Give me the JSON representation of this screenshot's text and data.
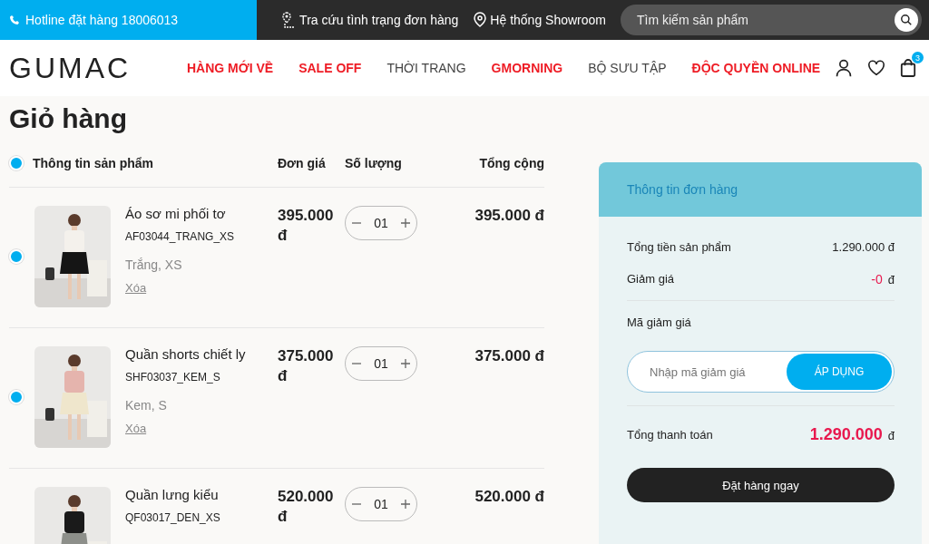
{
  "topbar": {
    "hotline": "Hotline đặt hàng 18006013",
    "links": [
      "Tra cứu tình trạng đơn hàng",
      "Hệ thống Showroom"
    ],
    "search": {
      "placeholder": "Tìm kiếm sản phẩm"
    }
  },
  "header": {
    "logo": "GUMAC",
    "menu": [
      {
        "label": "HÀNG MỚI VỀ",
        "highlight": true
      },
      {
        "label": "SALE OFF",
        "highlight": true
      },
      {
        "label": "THỜI TRANG",
        "highlight": false
      },
      {
        "label": "GMORNING",
        "highlight": true
      },
      {
        "label": "BỘ SƯU TẬP",
        "highlight": false
      },
      {
        "label": "ĐỘC QUYỀN ONLINE",
        "highlight": true
      }
    ],
    "cart_count": "3"
  },
  "page_title": "Giỏ hàng",
  "cart": {
    "select_all": {
      "selected": true
    },
    "columns": [
      "Thông tin sản phẩm",
      "Đơn giá",
      "Số lượng",
      "Tổng cộng"
    ],
    "items": [
      {
        "selected": true,
        "name": "Áo sơ mi phối tơ",
        "sku": "AF03044_TRANG_XS",
        "variant": "Trắng, XS",
        "remove": "Xóa",
        "price": "395.000 đ",
        "quantity": "01",
        "total": "395.000 đ"
      },
      {
        "selected": true,
        "name": "Quần shorts chiết ly",
        "sku": "SHF03037_KEM_S",
        "variant": "Kem, S",
        "remove": "Xóa",
        "price": "375.000 đ",
        "quantity": "01",
        "total": "375.000 đ"
      },
      {
        "name": "Quần lưng kiểu",
        "sku": "QF03017_DEN_XS",
        "price": "520.000 đ",
        "quantity": "01",
        "total": "520.000 đ"
      }
    ]
  },
  "summary": {
    "title": "Thông tin đơn hàng",
    "subtotal_label": "Tổng tiền sản phẩm",
    "subtotal": "1.290.000 đ",
    "discount_label": "Giảm giá",
    "discount": "-0",
    "discount_currency": "đ",
    "coupon_label": "Mã giảm giá",
    "coupon_placeholder": "Nhập mã giảm giá",
    "apply": "ÁP DỤNG",
    "total_label": "Tổng thanh toán",
    "total": "1.290.000",
    "total_currency": "đ",
    "order_button": "Đặt hàng ngay"
  }
}
